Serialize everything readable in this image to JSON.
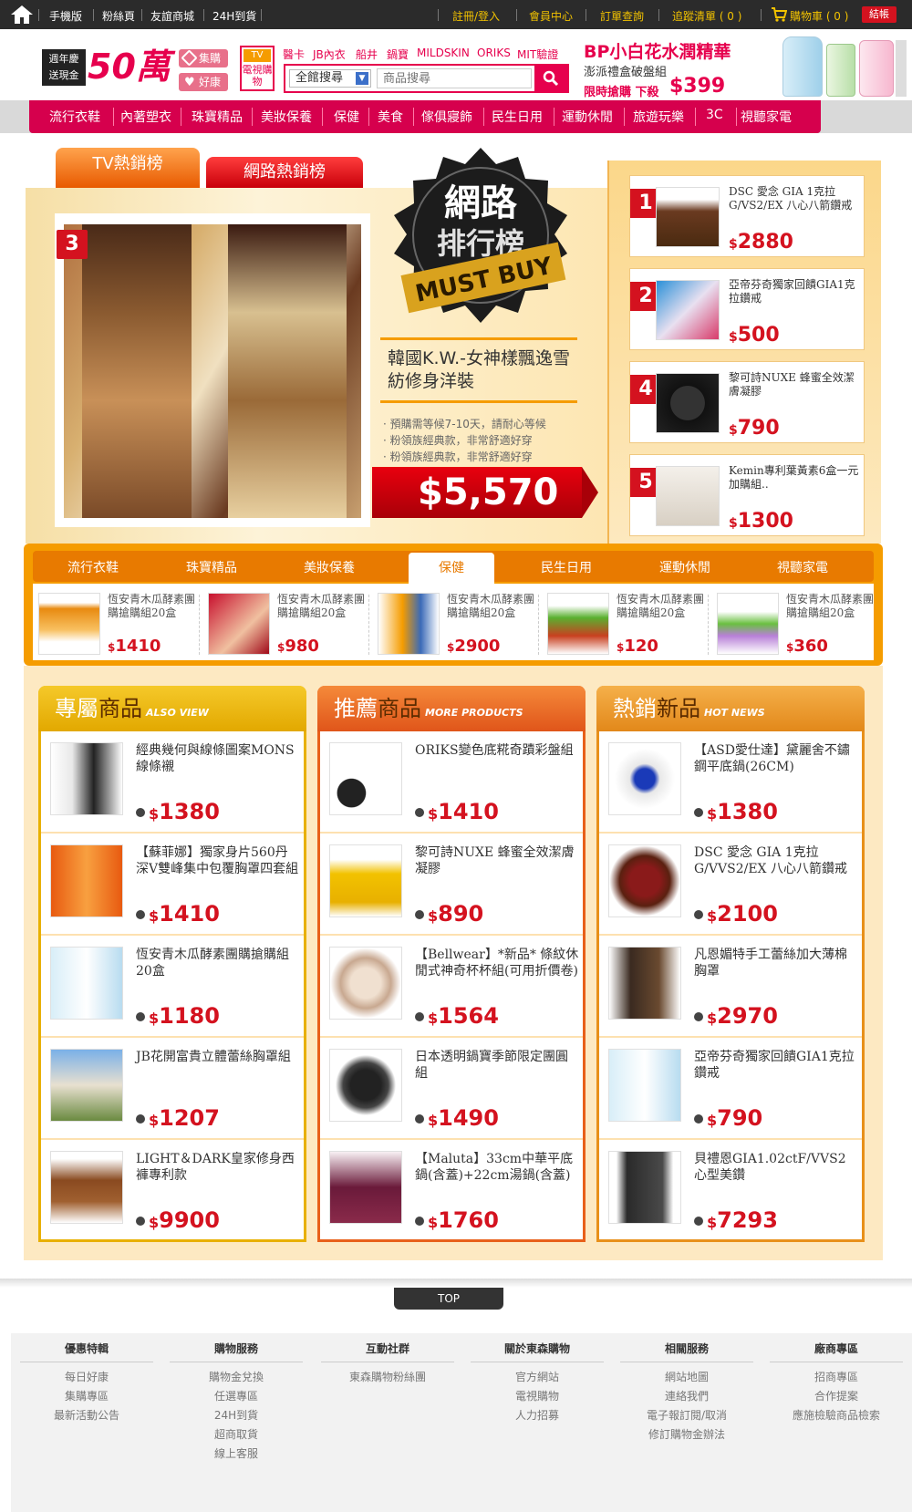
{
  "topbar": {
    "links": [
      "手機版",
      "粉絲頁",
      "友誼商城",
      "24H到貨"
    ],
    "right_links": [
      "註冊/登入",
      "會員中心",
      "訂單查詢",
      "追蹤清單 ( 0 )",
      "購物車 ( 0 )"
    ],
    "checkout_label": "結帳"
  },
  "header": {
    "logo_text_1": "週年慶",
    "logo_text_2": "送現金",
    "logo_big": "50萬",
    "chip_1": "集購",
    "chip_2": "好康",
    "tv_label_1": "TV",
    "tv_label_2": "電視購物",
    "hot_links": [
      "醫卡",
      "JB內衣",
      "船井",
      "鍋寶",
      "MILDSKIN",
      "ORIKS",
      "MIT驗證"
    ],
    "search_scope": "全館搜尋",
    "search_placeholder": "商品搜尋",
    "banner_title": "BP小白花水潤精華",
    "banner_sub": "澎派禮盒破盤組",
    "banner_promo": "限時搶購 下殺",
    "banner_price": "$399"
  },
  "nav": [
    "流行衣鞋",
    "內著塑衣",
    "珠寶精品",
    "美妝保養",
    "保健",
    "美食",
    "傢俱寢飾",
    "民生日用",
    "運動休閒",
    "旅遊玩樂",
    "3C",
    "視聽家電"
  ],
  "tabs": {
    "tv": "TV熱銷榜",
    "net": "網路熱銷榜"
  },
  "seal": {
    "line1": "網路",
    "line2": "排行榜",
    "line3": "MUST BUY"
  },
  "featured": {
    "rank": "3",
    "title": "韓國K.W.-女神樣飄逸雪紡修身洋裝",
    "bullets": [
      "預購需等候7-10天，請耐心等候",
      "粉領族經典款，非常舒適好穿",
      "粉領族經典款，非常舒適好穿"
    ],
    "price": "$5,570"
  },
  "ranks": [
    {
      "num": "1",
      "name": "DSC 愛念 GIA 1克拉G/VS2/EX 八心八箭鑽戒",
      "price": "2880"
    },
    {
      "num": "2",
      "name": "亞帝芬奇獨家回饋GIA1克拉鑽戒",
      "price": "500"
    },
    {
      "num": "4",
      "name": "黎可詩NUXE 蜂蜜全效潔膚凝膠",
      "price": "790"
    },
    {
      "num": "5",
      "name": "Kemin專利葉黃素6盒一元加購組..",
      "price": "1300"
    }
  ],
  "category_tabs": [
    "流行衣鞋",
    "珠寶精品",
    "美妝保養",
    "保健",
    "民生日用",
    "運動休閒",
    "視聽家電"
  ],
  "category_items": [
    {
      "name": "恆安青木瓜酵素團購搶購組20盒",
      "price": "1410"
    },
    {
      "name": "恆安青木瓜酵素團購搶購組20盒",
      "price": "980"
    },
    {
      "name": "恆安青木瓜酵素團購搶購組20盒",
      "price": "2900"
    },
    {
      "name": "恆安青木瓜酵素團購搶購組20盒",
      "price": "120"
    },
    {
      "name": "恆安青木瓜酵素團購搶購組20盒",
      "price": "360"
    }
  ],
  "sections": [
    {
      "title_a": "專屬",
      "title_b": "商品",
      "sub": "ALSO VIEW",
      "color": "#e8b000",
      "items": [
        {
          "name": "經典幾何與線條圖案MONS線條襯",
          "price": "1380"
        },
        {
          "name": "【蘇菲娜】獨家身片560丹深V雙峰集中包覆胸罩四套組",
          "price": "1410"
        },
        {
          "name": "恆安青木瓜酵素團購搶購組20盒",
          "price": "1180"
        },
        {
          "name": "JB花開富貴立體蕾絲胸罩組",
          "price": "1207"
        },
        {
          "name": "LIGHT＆DARK皇家修身西褲專利款",
          "price": "9900"
        }
      ]
    },
    {
      "title_a": "推薦",
      "title_b": "商品",
      "sub": "MORE PRODUCTS",
      "color": "#e8601a",
      "items": [
        {
          "name": "ORIKS變色底糀奇蹟彩盤組",
          "price": "1410"
        },
        {
          "name": "黎可詩NUXE 蜂蜜全效潔膚凝膠",
          "price": "890"
        },
        {
          "name": "【Bellwear】*新品* 條紋休閒式神奇杯杯組(可用折價卷)",
          "price": "1564"
        },
        {
          "name": "日本透明鍋寶季節限定團圓組",
          "price": "1490"
        },
        {
          "name": "【Maluta】33cm中華平底鍋(含蓋)+22cm湯鍋(含蓋)",
          "price": "1760"
        }
      ]
    },
    {
      "title_a": "熱銷",
      "title_b": "新品",
      "sub": "HOT NEWS",
      "color": "#e8901a",
      "items": [
        {
          "name": "【ASD愛仕達】黛麗舍不鏽鋼平底鍋(26CM)",
          "price": "1380"
        },
        {
          "name": "DSC 愛念 GIA 1克拉G/VVS2/EX 八心八箭鑽戒",
          "price": "2100"
        },
        {
          "name": "凡恩媚特手工蕾絲加大薄棉胸罩",
          "price": "2970"
        },
        {
          "name": "亞帝芬奇獨家回饋GIA1克拉鑽戒",
          "price": "790"
        },
        {
          "name": "貝禮恩GIA1.02ctF/VVS2心型美鑽",
          "price": "7293"
        }
      ]
    }
  ],
  "top_label": "TOP",
  "footer": [
    {
      "title": "優惠特輯",
      "links": [
        "每日好康",
        "集購專區",
        "最新活動公告"
      ]
    },
    {
      "title": "購物服務",
      "links": [
        "購物金兌換",
        "任選專區",
        "24H到貨",
        "超商取貨",
        "線上客服"
      ]
    },
    {
      "title": "互動社群",
      "links": [
        "東森購物粉絲團"
      ]
    },
    {
      "title": "關於東森購物",
      "links": [
        "官方網站",
        "電視購物",
        "人力招募"
      ]
    },
    {
      "title": "相關服務",
      "links": [
        "網站地圖",
        "連絡我們",
        "電子報訂閱/取消",
        "修訂購物金辦法"
      ]
    },
    {
      "title": "廠商專區",
      "links": [
        "招商專區",
        "合作提案",
        "應施檢驗商品檢索"
      ]
    }
  ]
}
